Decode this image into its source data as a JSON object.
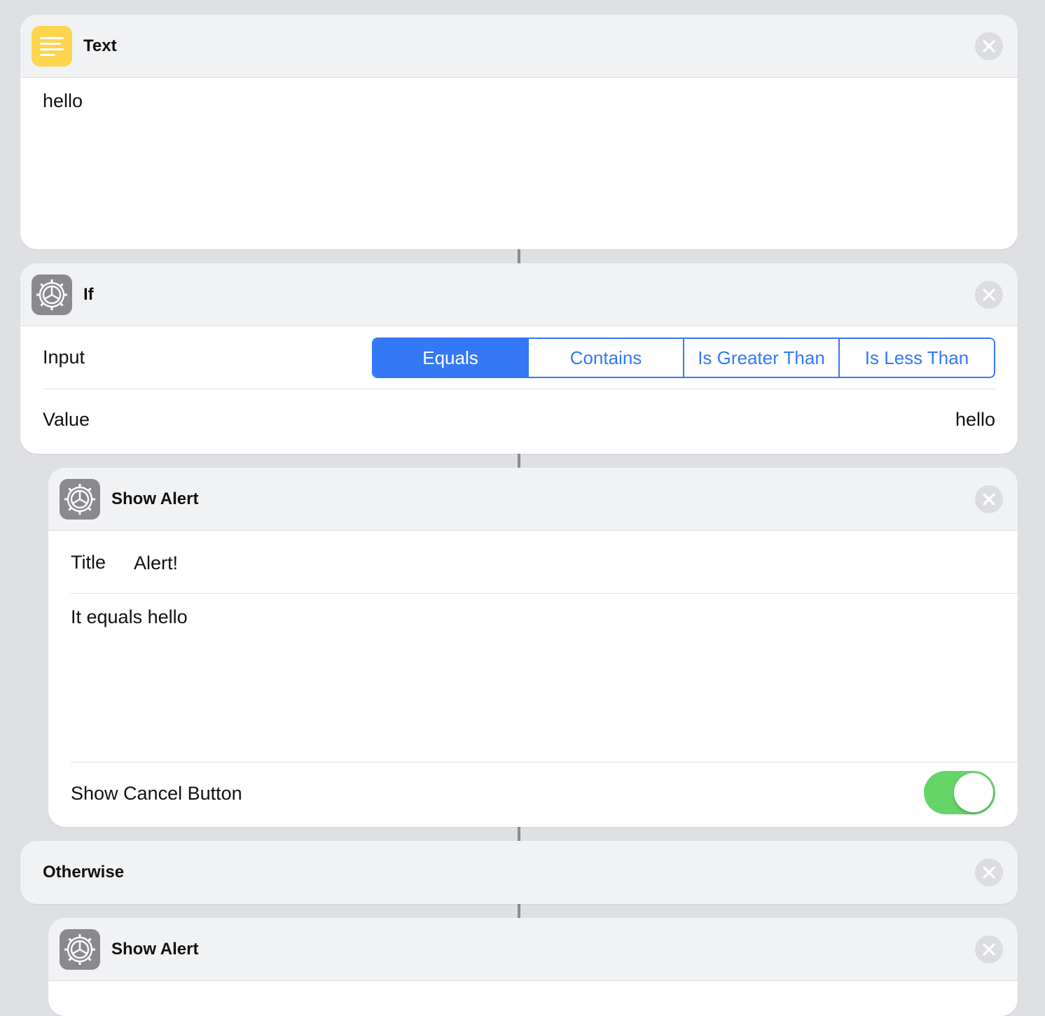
{
  "text_action": {
    "title": "Text",
    "icon": "text-lines-icon",
    "content": "hello"
  },
  "if_action": {
    "title": "If",
    "icon": "gear-icon",
    "input_label": "Input",
    "conditions": [
      "Equals",
      "Contains",
      "Is Greater Than",
      "Is Less Than"
    ],
    "selected_condition": "Equals",
    "value_label": "Value",
    "value": "hello"
  },
  "alert_action_1": {
    "title": "Show Alert",
    "icon": "gear-icon",
    "title_label": "Title",
    "title_value": "Alert!",
    "message": "It equals hello",
    "cancel_label": "Show Cancel Button",
    "cancel_enabled": true
  },
  "otherwise_action": {
    "title": "Otherwise"
  },
  "alert_action_2": {
    "title": "Show Alert",
    "icon": "gear-icon"
  },
  "colors": {
    "accent": "#3478f6",
    "toggle_on": "#65d56a",
    "text_icon_bg": "#fdd54e",
    "settings_icon_bg": "#8a8a8e",
    "background": "#dfe0e3"
  }
}
